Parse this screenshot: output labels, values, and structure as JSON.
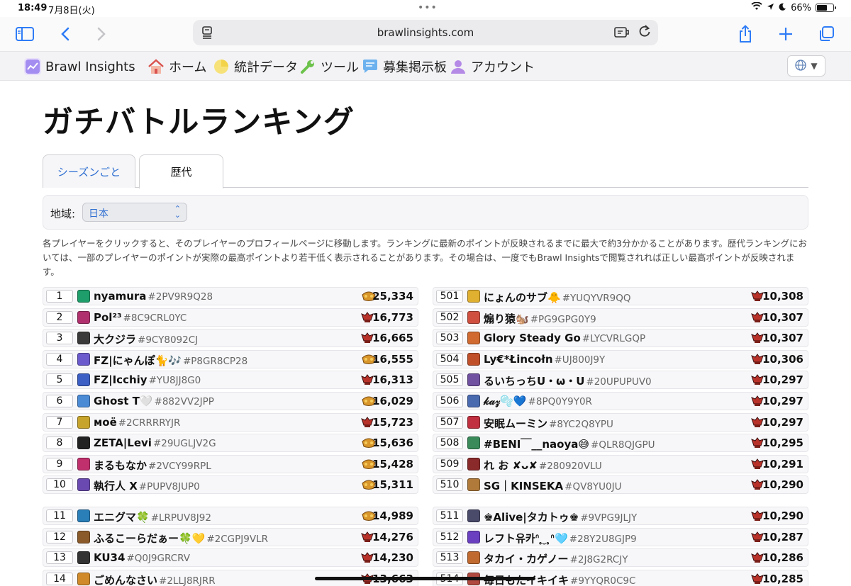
{
  "status": {
    "time": "18:49",
    "date": "7月8日(火)",
    "battery": "66%",
    "battery_level": 0.66
  },
  "browser": {
    "url": "brawlinsights.com"
  },
  "nav": {
    "brand": "Brawl Insights",
    "items": [
      {
        "label": "ホーム",
        "icon": "house-icon"
      },
      {
        "label": "統計データ",
        "icon": "chart-icon"
      },
      {
        "label": "ツール",
        "icon": "wrench-icon"
      },
      {
        "label": "募集掲示板",
        "icon": "chat-icon"
      },
      {
        "label": "アカウント",
        "icon": "person-icon"
      }
    ]
  },
  "page": {
    "title": "ガチバトルランキング",
    "tabs": [
      "シーズンごと",
      "歴代"
    ],
    "active_tab": "歴代",
    "filter_label": "地域:",
    "region": "日本",
    "description": "各プレイヤーをクリックすると、そのプレイヤーのプロフィールページに移動します。ランキングに最新のポイントが反映されるまでに最大で約3分かかることがあります。歴代ランキングにおいては、一部のプレイヤーのポイントが実際の最高ポイントより若干低く表示されることがあります。その場合は、一度でもBrawl Insightsで閲覧されれば正しい最高ポイントが反映されます。"
  },
  "colors": {
    "accent": "#2f7cf6",
    "link": "#2f6fd1",
    "row_bg": "#f7f7f9"
  },
  "left_rows": [
    {
      "rank": "1",
      "name": "nyamura",
      "tag": "#2PV9R9Q28",
      "score": "25,334",
      "trophy": "gold",
      "avatar": "#1e9e6a"
    },
    {
      "rank": "2",
      "name": "Pol²³",
      "tag": "#8C9CRL0YC",
      "score": "16,773",
      "trophy": "red",
      "avatar": "#b0306d"
    },
    {
      "rank": "3",
      "name": "大クジラ",
      "tag": "#9CY8092CJ",
      "score": "16,665",
      "trophy": "red",
      "avatar": "#3a3a3a"
    },
    {
      "rank": "4",
      "name": "FZ|にゃんぽ🐈🎶",
      "tag": "#P8GR8CP28",
      "score": "16,555",
      "trophy": "gold",
      "avatar": "#6a5acd"
    },
    {
      "rank": "5",
      "name": "FZ|Icchiy",
      "tag": "#YU8JJ8G0",
      "score": "16,313",
      "trophy": "red",
      "avatar": "#3b5fc4"
    },
    {
      "rank": "6",
      "name": "Ghost T🤍",
      "tag": "#882VV2JPP",
      "score": "16,029",
      "trophy": "gold",
      "avatar": "#4b8bd6"
    },
    {
      "rank": "7",
      "name": "моё",
      "tag": "#2CRRRRYJR",
      "score": "15,723",
      "trophy": "red",
      "avatar": "#c7a42c"
    },
    {
      "rank": "8",
      "name": "ZETA|Levi",
      "tag": "#29UGLJV2G",
      "score": "15,636",
      "trophy": "gold",
      "avatar": "#222222"
    },
    {
      "rank": "9",
      "name": "まるもなか",
      "tag": "#2VCY99RPL",
      "score": "15,428",
      "trophy": "gold",
      "avatar": "#c0306d"
    },
    {
      "rank": "10",
      "name": "執行人 X",
      "tag": "#PUPV8JUP0",
      "score": "15,311",
      "trophy": "gold",
      "avatar": "#6a4ab0"
    },
    {
      "rank": "11",
      "name": "エニグマ🍀",
      "tag": "#LRPUV8J92",
      "score": "14,989",
      "trophy": "gold",
      "avatar": "#2a7fb8"
    },
    {
      "rank": "12",
      "name": "ふるこーらだぁー🍀💛",
      "tag": "#2CGPJ9VLR",
      "score": "14,276",
      "trophy": "red",
      "avatar": "#8a5a2a"
    },
    {
      "rank": "13",
      "name": "KU34",
      "tag": "#Q0J9GRCRV",
      "score": "14,230",
      "trophy": "red",
      "avatar": "#333333"
    },
    {
      "rank": "14",
      "name": "ごめんなさい",
      "tag": "#2LLJ8RJRR",
      "score": "13,663",
      "trophy": "red",
      "avatar": "#d08a2a"
    }
  ],
  "right_rows": [
    {
      "rank": "501",
      "name": "にょんのサブ🐥",
      "tag": "#YUQYVR9QQ",
      "score": "10,308",
      "trophy": "red",
      "avatar": "#e0b030"
    },
    {
      "rank": "502",
      "name": "煽り猿🐿️",
      "tag": "#PG9GPG0Y9",
      "score": "10,307",
      "trophy": "red",
      "avatar": "#d05040"
    },
    {
      "rank": "503",
      "name": "Glory Steady Go",
      "tag": "#LYCVRLGQP",
      "score": "10,307",
      "trophy": "red",
      "avatar": "#d06a30"
    },
    {
      "rank": "504",
      "name": "Ly€*Łincołn",
      "tag": "#UJ800J9Y",
      "score": "10,306",
      "trophy": "red",
      "avatar": "#c0502a"
    },
    {
      "rank": "505",
      "name": "るいちっちU・ω・U",
      "tag": "#20UPUPUV0",
      "score": "10,297",
      "trophy": "red",
      "avatar": "#7050a0"
    },
    {
      "rank": "506",
      "name": "𝓀𝒶𝓏🫧💙",
      "tag": "#8PQ0Y9Y0R",
      "score": "10,297",
      "trophy": "red",
      "avatar": "#4a6ab0"
    },
    {
      "rank": "507",
      "name": "安眠ムーミン",
      "tag": "#8YC2Q8YPU",
      "score": "10,297",
      "trophy": "red",
      "avatar": "#c03040"
    },
    {
      "rank": "508",
      "name": "#BENI￣__naoya😅",
      "tag": "#QLR8QJGPU",
      "score": "10,295",
      "trophy": "red",
      "avatar": "#3a8a5a"
    },
    {
      "rank": "509",
      "name": "れ お ✘ᴗ✘",
      "tag": "#280920VLU",
      "score": "10,291",
      "trophy": "red",
      "avatar": "#8a2a2a"
    },
    {
      "rank": "510",
      "name": "SG｜KINSEKA",
      "tag": "#QV8YU0JU",
      "score": "10,290",
      "trophy": "red",
      "avatar": "#b07a3a"
    },
    {
      "rank": "511",
      "name": "♚Alive|タカトゥ♚",
      "tag": "#9VPG9JLJY",
      "score": "10,290",
      "trophy": "red",
      "avatar": "#4a4a6a"
    },
    {
      "rank": "512",
      "name": "レフト유카ᐢ ̥ ̮ ̥ᐢ🩵",
      "tag": "#28Y2U8GJP9",
      "score": "10,287",
      "trophy": "red",
      "avatar": "#6a40c0"
    },
    {
      "rank": "513",
      "name": "タカイ・カゲノー",
      "tag": "#2J8G2RCJY",
      "score": "10,286",
      "trophy": "red",
      "avatar": "#c06a30"
    },
    {
      "rank": "514",
      "name": "毎日もたイキイキ",
      "tag": "#9YYQR0C9C",
      "score": "10,285",
      "trophy": "red",
      "avatar": "#b04a40"
    }
  ]
}
